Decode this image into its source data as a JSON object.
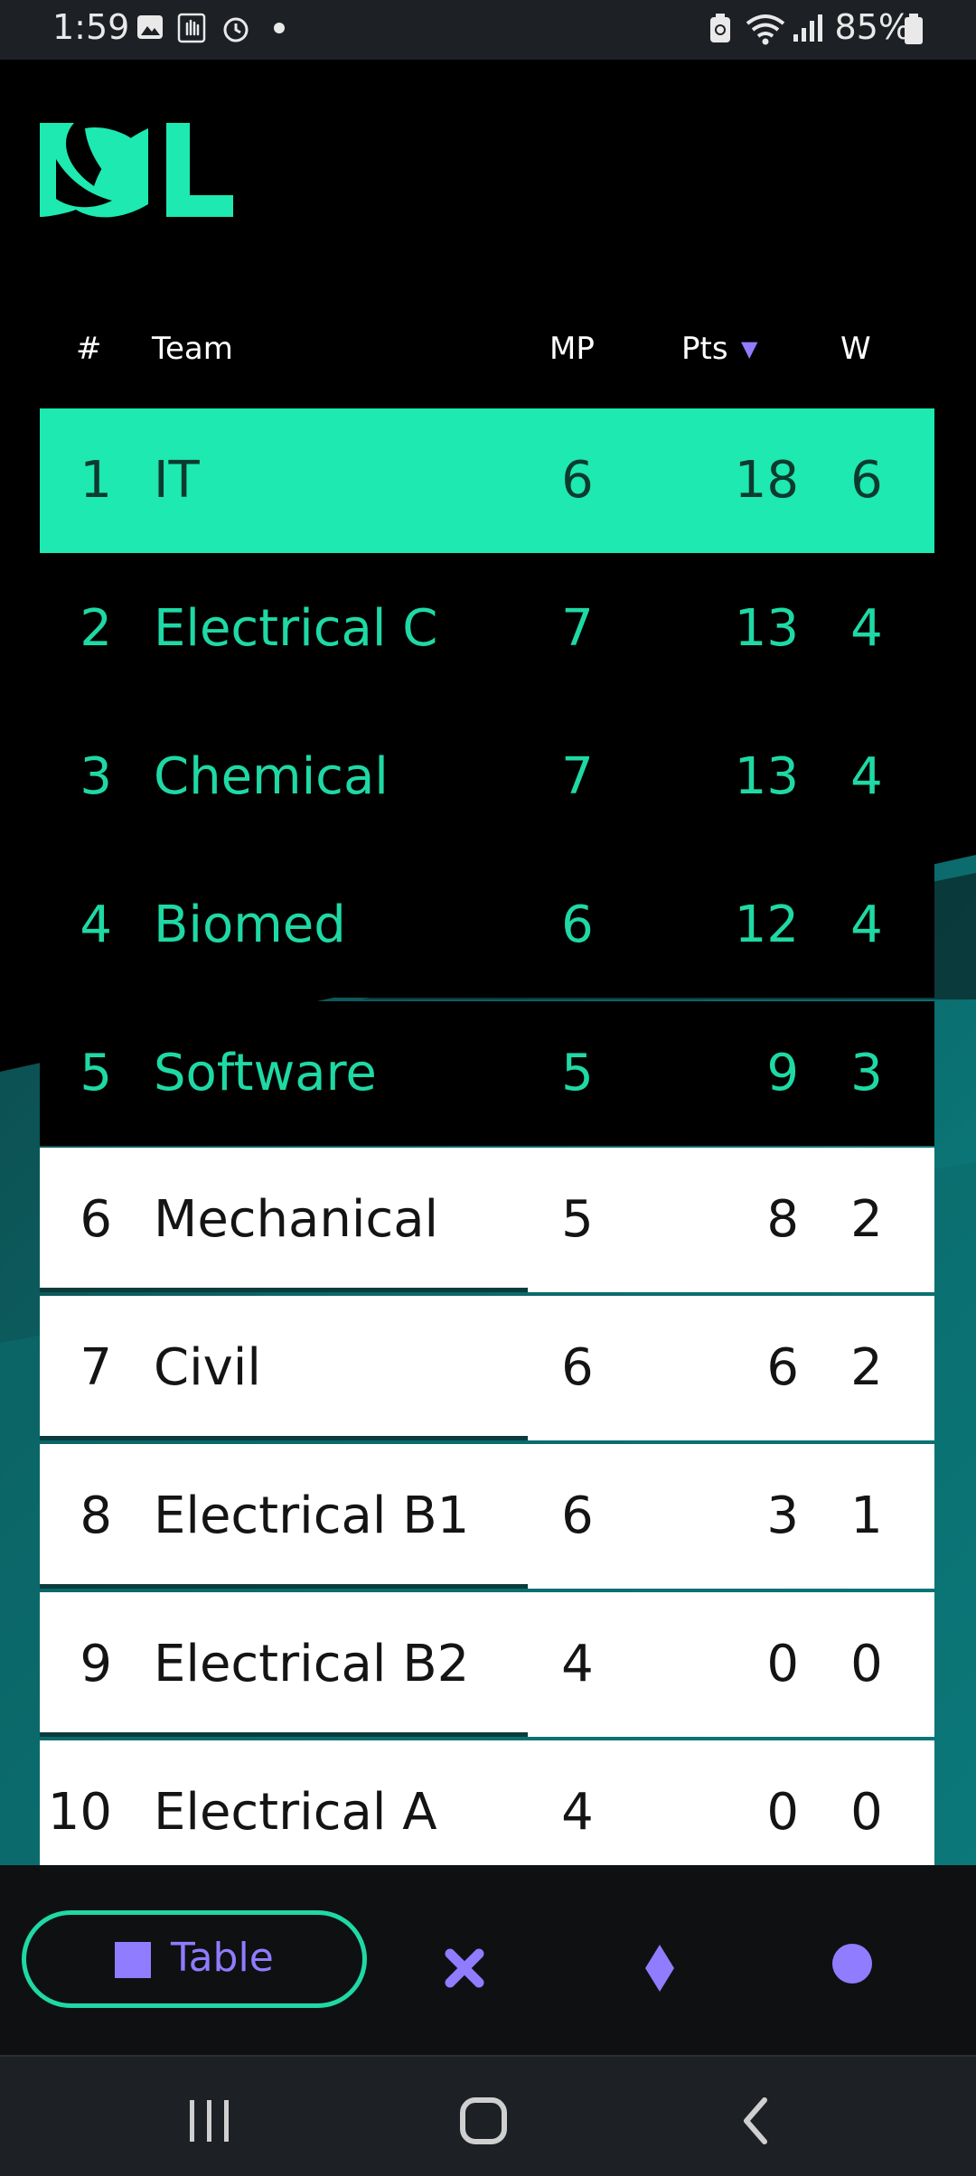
{
  "status_bar": {
    "time": "1:59",
    "battery": "85%",
    "icons": [
      "image-icon",
      "hand-icon",
      "alarm-icon",
      "dot-icon",
      "battery-saver-icon",
      "wifi-icon",
      "signal-icon",
      "battery-icon"
    ]
  },
  "colors": {
    "accent": "#1de9b0",
    "text_green": "#1fd9a5",
    "purple": "#8f7cff",
    "background": "#000000"
  },
  "table": {
    "headers": {
      "rank": "#",
      "team": "Team",
      "mp": "MP",
      "pts": "Pts",
      "w": "W",
      "sort_indicator": "▼"
    },
    "rows": [
      {
        "rank": "1",
        "team": "IT",
        "mp": "6",
        "pts": "18",
        "w": "6"
      },
      {
        "rank": "2",
        "team": "Electrical C",
        "mp": "7",
        "pts": "13",
        "w": "4"
      },
      {
        "rank": "3",
        "team": "Chemical",
        "mp": "7",
        "pts": "13",
        "w": "4"
      },
      {
        "rank": "4",
        "team": "Biomed",
        "mp": "6",
        "pts": "12",
        "w": "4"
      },
      {
        "rank": "5",
        "team": "Software",
        "mp": "5",
        "pts": "9",
        "w": "3"
      },
      {
        "rank": "6",
        "team": "Mechanical",
        "mp": "5",
        "pts": "8",
        "w": "2"
      },
      {
        "rank": "7",
        "team": "Civil",
        "mp": "6",
        "pts": "6",
        "w": "2"
      },
      {
        "rank": "8",
        "team": "Electrical B1",
        "mp": "6",
        "pts": "3",
        "w": "1"
      },
      {
        "rank": "9",
        "team": "Electrical B2",
        "mp": "4",
        "pts": "0",
        "w": "0"
      },
      {
        "rank": "10",
        "team": "Electrical A",
        "mp": "4",
        "pts": "0",
        "w": "0"
      }
    ]
  },
  "tabbar": {
    "table_label": "Table",
    "icons": [
      "square-icon",
      "cross-icon",
      "diamond-icon",
      "circle-icon"
    ]
  },
  "navbar": {
    "icons": [
      "recent-apps-icon",
      "home-icon",
      "back-icon"
    ]
  }
}
